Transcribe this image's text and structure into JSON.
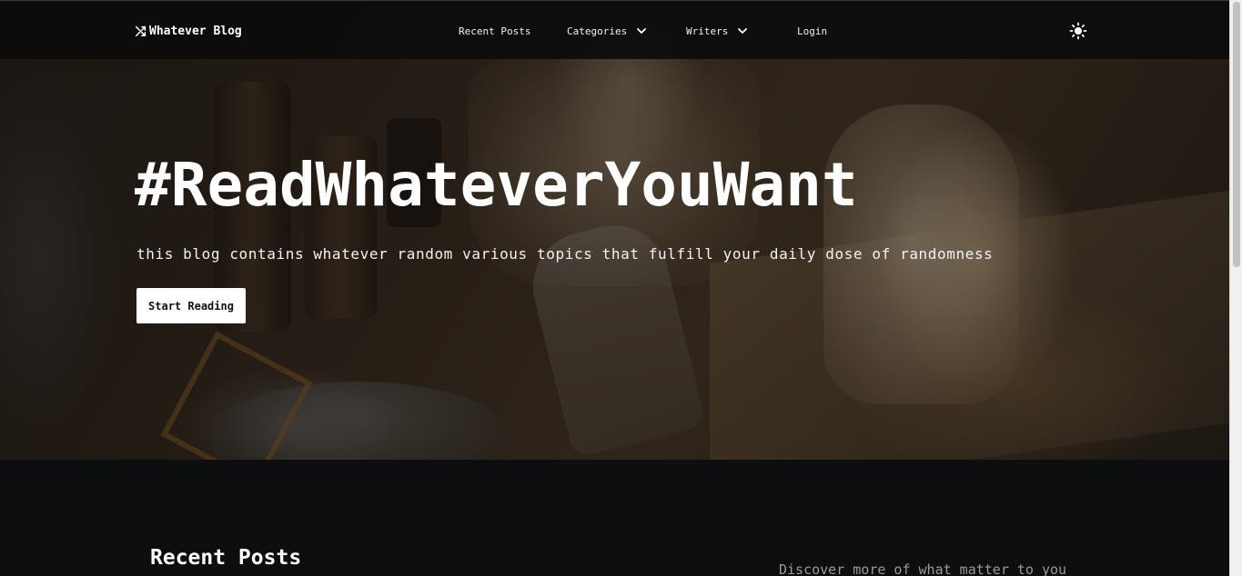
{
  "navbar": {
    "brand": "Whatever Blog",
    "brand_icon": "shuffle-icon",
    "items": [
      {
        "label": "Recent Posts",
        "has_dropdown": false
      },
      {
        "label": "Categories",
        "has_dropdown": true
      },
      {
        "label": "Writers",
        "has_dropdown": true
      },
      {
        "label": "Login",
        "has_dropdown": false
      }
    ],
    "theme_toggle_icon": "sun-icon"
  },
  "hero": {
    "title": "#ReadWhateverYouWant",
    "subtitle": "this blog contains whatever random various topics that fulfill your daily dose of randomness",
    "cta_label": "Start Reading"
  },
  "content": {
    "section_title": "Recent Posts",
    "side_tagline": "Discover more of what matter to you"
  },
  "colors": {
    "background": "#0d0e10",
    "navbar": "#0a0a0a",
    "text": "#ffffff",
    "muted_text": "#9a9a9a",
    "button_bg": "#ffffff",
    "button_text": "#111111"
  }
}
